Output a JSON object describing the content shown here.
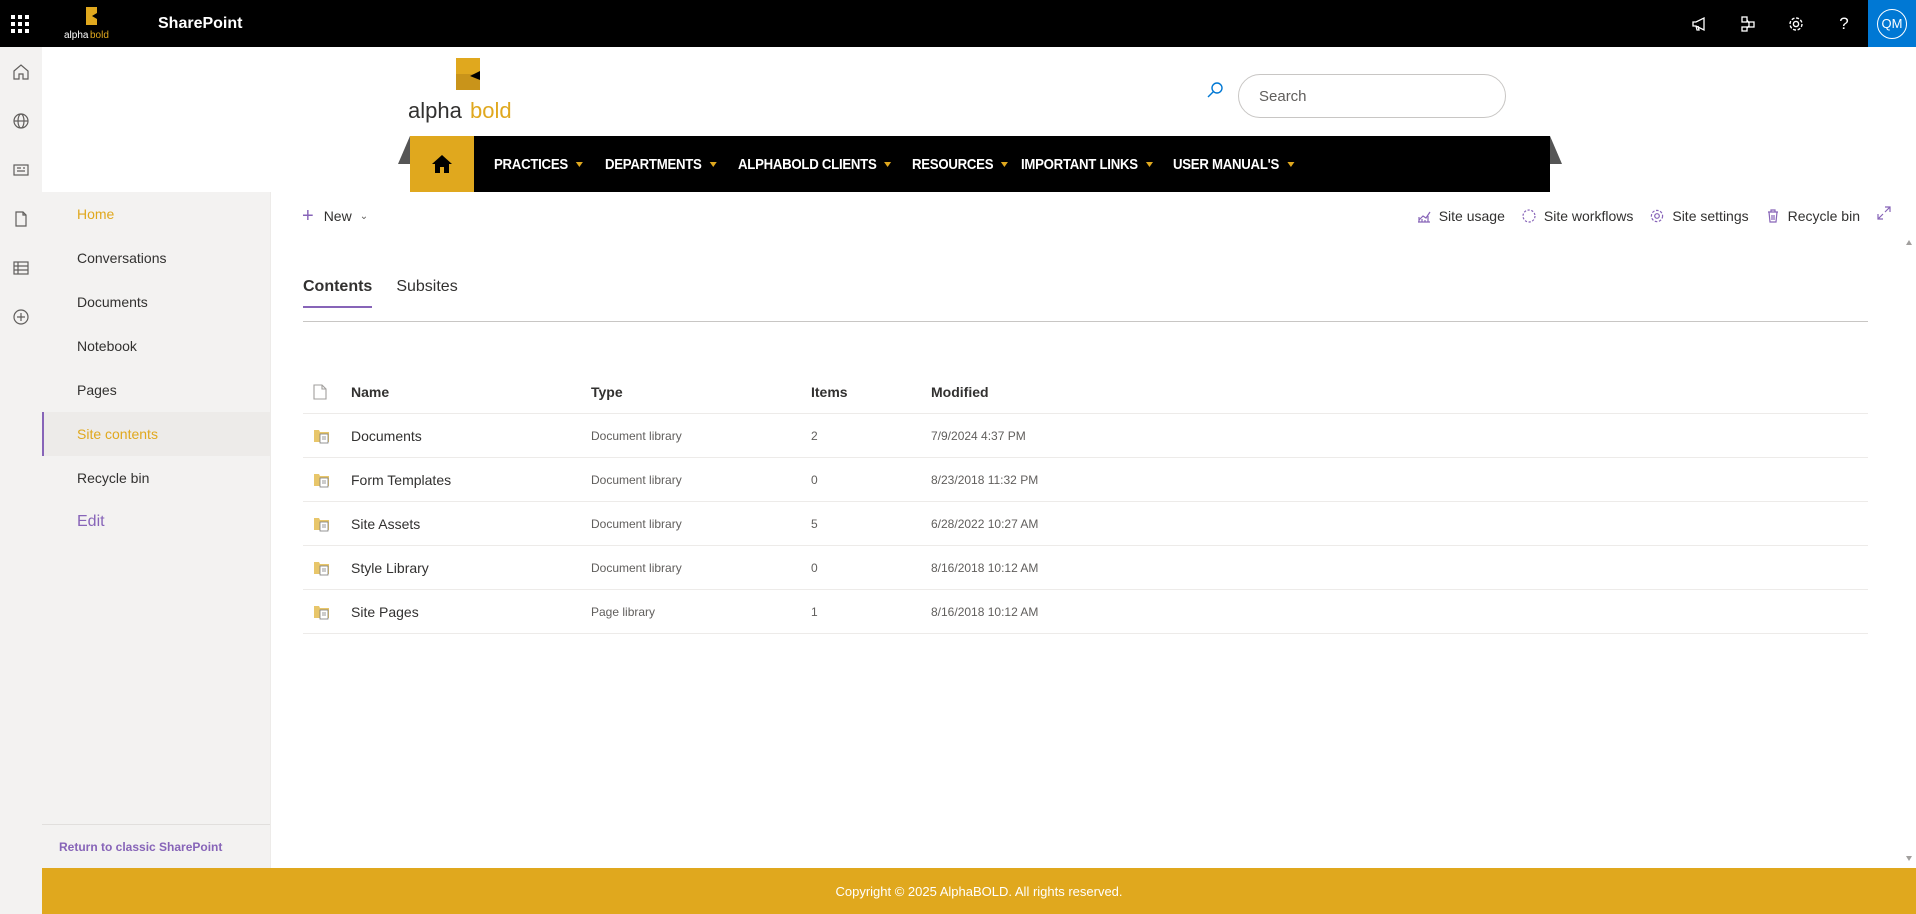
{
  "suite": {
    "app_name": "SharePoint",
    "logo_text_alpha": "alpha",
    "logo_text_bold": "bold",
    "user_initials": "QM"
  },
  "site": {
    "logo_text_alpha": "alpha",
    "logo_text_bold": "bold"
  },
  "search": {
    "placeholder": "Search"
  },
  "nav": {
    "items": [
      {
        "label": "PRACTICES"
      },
      {
        "label": "DEPARTMENTS"
      },
      {
        "label": "ALPHABOLD CLIENTS"
      },
      {
        "label": "RESOURCES"
      },
      {
        "label": "IMPORTANT LINKS"
      },
      {
        "label": "USER MANUAL'S"
      }
    ]
  },
  "leftnav": {
    "items": [
      {
        "label": "Home"
      },
      {
        "label": "Conversations"
      },
      {
        "label": "Documents"
      },
      {
        "label": "Notebook"
      },
      {
        "label": "Pages"
      },
      {
        "label": "Site contents"
      },
      {
        "label": "Recycle bin"
      }
    ],
    "edit_label": "Edit",
    "classic_link": "Return to classic SharePoint"
  },
  "commandbar": {
    "new_label": "New",
    "site_usage": "Site usage",
    "site_workflows": "Site workflows",
    "site_settings": "Site settings",
    "recycle_bin": "Recycle bin"
  },
  "pivot": {
    "tabs": [
      {
        "label": "Contents"
      },
      {
        "label": "Subsites"
      }
    ]
  },
  "table": {
    "headers": {
      "name": "Name",
      "type": "Type",
      "items": "Items",
      "modified": "Modified"
    },
    "rows": [
      {
        "name": "Documents",
        "type": "Document library",
        "items": "2",
        "modified": "7/9/2024 4:37 PM"
      },
      {
        "name": "Form Templates",
        "type": "Document library",
        "items": "0",
        "modified": "8/23/2018 11:32 PM"
      },
      {
        "name": "Site Assets",
        "type": "Document library",
        "items": "5",
        "modified": "6/28/2022 10:27 AM"
      },
      {
        "name": "Style Library",
        "type": "Document library",
        "items": "0",
        "modified": "8/16/2018 10:12 AM"
      },
      {
        "name": "Site Pages",
        "type": "Page library",
        "items": "1",
        "modified": "8/16/2018 10:12 AM"
      }
    ]
  },
  "footer": {
    "text": "Copyright © 2025 AlphaBOLD. All rights reserved."
  },
  "colors": {
    "brand_gold": "#e0a81e",
    "accent_purple": "#8764b8",
    "suite_black": "#000000"
  }
}
